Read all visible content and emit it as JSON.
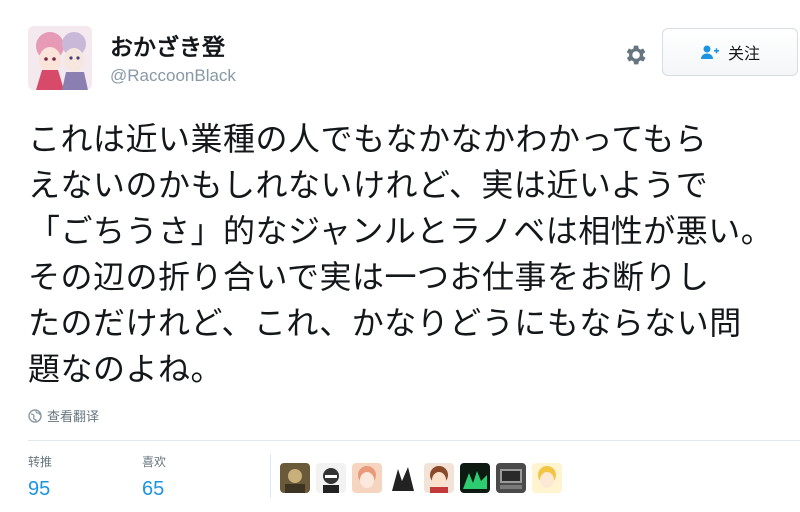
{
  "user": {
    "display_name": "おかざき登",
    "handle": "@RaccoonBlack"
  },
  "actions": {
    "follow_label": "关注"
  },
  "tweet": {
    "lines": [
      "これは近い業種の人でもなかなかわかってもら",
      "えないのかもしれないけれど、実は近いようで",
      "「ごちうさ」的なジャンルとラノベは相性が悪い。",
      "その辺の折り合いで実は一つお仕事をお断りし",
      "たのだけれど、これ、かなりどうにもならない問",
      "題なのよね。"
    ],
    "translate_label": "查看翻译"
  },
  "stats": {
    "retweets_label": "转推",
    "retweets": "95",
    "likes_label": "喜欢",
    "likes": "65"
  },
  "liker_avatars": [
    "avatar-1",
    "avatar-2",
    "avatar-3",
    "avatar-4",
    "avatar-5",
    "avatar-6",
    "avatar-7",
    "avatar-8"
  ],
  "colors": {
    "link": "#1b95e0",
    "muted": "#8899a6",
    "text": "#14171a"
  }
}
